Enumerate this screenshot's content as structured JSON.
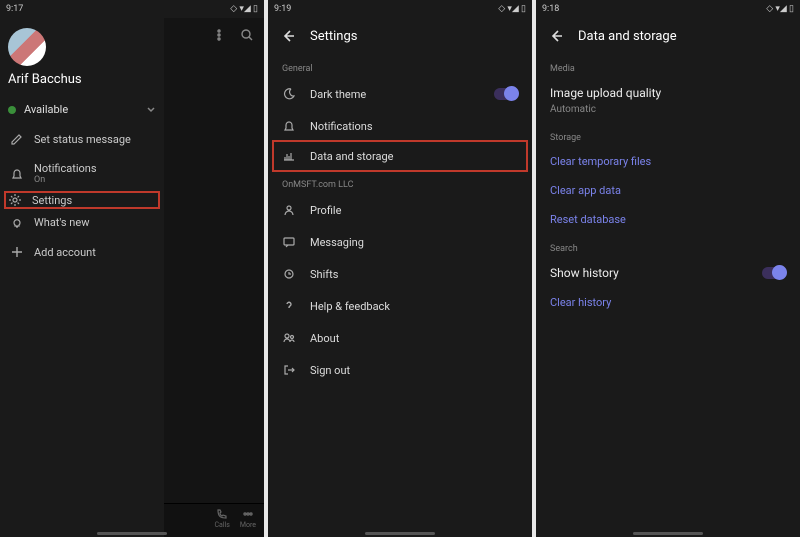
{
  "status": {
    "times": [
      "9:17",
      "9:19",
      "9:18"
    ],
    "iconset": "▢ ▮",
    "right_icons": "◇ ▾◢ ▯"
  },
  "screen1": {
    "username": "Arif Bacchus",
    "presence": "Available",
    "items": [
      {
        "label": "Set status message"
      },
      {
        "label": "Notifications",
        "sub": "On"
      },
      {
        "label": "Settings",
        "highlight": true
      },
      {
        "label": "What's new"
      },
      {
        "label": "Add account"
      }
    ],
    "nav": {
      "calls": "Calls",
      "more": "More"
    }
  },
  "screen2": {
    "title": "Settings",
    "section_general": "General",
    "general_items": [
      {
        "label": "Dark theme",
        "toggle": true
      },
      {
        "label": "Notifications"
      },
      {
        "label": "Data and storage",
        "highlight": true
      }
    ],
    "section_org": "OnMSFT.com LLC",
    "org_items": [
      {
        "label": "Profile"
      },
      {
        "label": "Messaging"
      },
      {
        "label": "Shifts"
      },
      {
        "label": "Help & feedback"
      },
      {
        "label": "About"
      },
      {
        "label": "Sign out"
      }
    ]
  },
  "screen3": {
    "title": "Data and storage",
    "section_media": "Media",
    "media_item": {
      "label": "Image upload quality",
      "sub": "Automatic"
    },
    "section_storage": "Storage",
    "storage_links": [
      "Clear temporary files",
      "Clear app data",
      "Reset database"
    ],
    "section_search": "Search",
    "search_toggle_label": "Show history",
    "search_clear": "Clear history"
  }
}
